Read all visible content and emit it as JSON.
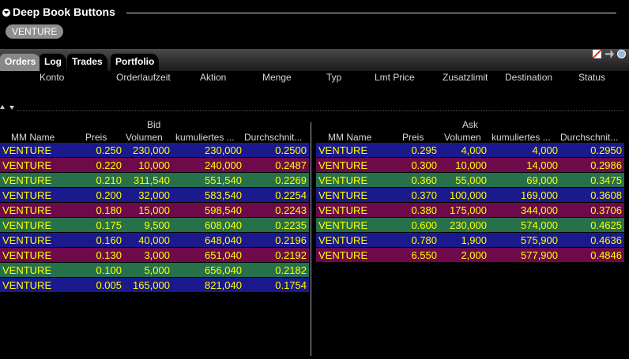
{
  "window": {
    "title": "Deep Book Buttons"
  },
  "symbol": "VENTURE",
  "tabs": [
    {
      "label": "Orders",
      "active": true
    },
    {
      "label": "Log",
      "active": false
    },
    {
      "label": "Trades",
      "active": false
    },
    {
      "label": "Portfolio",
      "active": false
    }
  ],
  "orders_columns": [
    "Konto",
    "Orderlaufzeit",
    "Aktion",
    "Menge",
    "Typ",
    "Lmt Price",
    "Zusatzlimit",
    "Destination",
    "Status"
  ],
  "colors": {
    "blue": "#1a1a8c",
    "purple": "#6e0a4a",
    "green": "#26704a",
    "text": "#ffff00"
  },
  "bid": {
    "title": "Bid",
    "columns": [
      "MM Name",
      "Preis",
      "Volumen",
      "kumuliertes ...",
      "Durchschnit..."
    ],
    "rows": [
      {
        "mm": "VENTURE",
        "price": "0.250",
        "volume": "230,000",
        "cum": "230,000",
        "avg": "0.2500",
        "color": "blue"
      },
      {
        "mm": "VENTURE",
        "price": "0.220",
        "volume": "10,000",
        "cum": "240,000",
        "avg": "0.2487",
        "color": "purple"
      },
      {
        "mm": "VENTURE",
        "price": "0.210",
        "volume": "311,540",
        "cum": "551,540",
        "avg": "0.2269",
        "color": "green"
      },
      {
        "mm": "VENTURE",
        "price": "0.200",
        "volume": "32,000",
        "cum": "583,540",
        "avg": "0.2254",
        "color": "blue"
      },
      {
        "mm": "VENTURE",
        "price": "0.180",
        "volume": "15,000",
        "cum": "598,540",
        "avg": "0.2243",
        "color": "purple"
      },
      {
        "mm": "VENTURE",
        "price": "0.175",
        "volume": "9,500",
        "cum": "608,040",
        "avg": "0.2235",
        "color": "green"
      },
      {
        "mm": "VENTURE",
        "price": "0.160",
        "volume": "40,000",
        "cum": "648,040",
        "avg": "0.2196",
        "color": "blue"
      },
      {
        "mm": "VENTURE",
        "price": "0.130",
        "volume": "3,000",
        "cum": "651,040",
        "avg": "0.2192",
        "color": "purple"
      },
      {
        "mm": "VENTURE",
        "price": "0.100",
        "volume": "5,000",
        "cum": "656,040",
        "avg": "0.2182",
        "color": "green"
      },
      {
        "mm": "VENTURE",
        "price": "0.005",
        "volume": "165,000",
        "cum": "821,040",
        "avg": "0.1754",
        "color": "blue"
      }
    ]
  },
  "ask": {
    "title": "Ask",
    "columns": [
      "MM Name",
      "Preis",
      "Volumen",
      "kumuliertes ...",
      "Durchschnit..."
    ],
    "rows": [
      {
        "mm": "VENTURE",
        "price": "0.295",
        "volume": "4,000",
        "cum": "4,000",
        "avg": "0.2950",
        "color": "blue"
      },
      {
        "mm": "VENTURE",
        "price": "0.300",
        "volume": "10,000",
        "cum": "14,000",
        "avg": "0.2986",
        "color": "purple"
      },
      {
        "mm": "VENTURE",
        "price": "0.360",
        "volume": "55,000",
        "cum": "69,000",
        "avg": "0.3475",
        "color": "green"
      },
      {
        "mm": "VENTURE",
        "price": "0.370",
        "volume": "100,000",
        "cum": "169,000",
        "avg": "0.3608",
        "color": "blue"
      },
      {
        "mm": "VENTURE",
        "price": "0.380",
        "volume": "175,000",
        "cum": "344,000",
        "avg": "0.3706",
        "color": "purple"
      },
      {
        "mm": "VENTURE",
        "price": "0.600",
        "volume": "230,000",
        "cum": "574,000",
        "avg": "0.4625",
        "color": "green"
      },
      {
        "mm": "VENTURE",
        "price": "0.780",
        "volume": "1,900",
        "cum": "575,900",
        "avg": "0.4636",
        "color": "blue"
      },
      {
        "mm": "VENTURE",
        "price": "6.550",
        "volume": "2,000",
        "cum": "577,900",
        "avg": "0.4846",
        "color": "purple"
      }
    ]
  }
}
